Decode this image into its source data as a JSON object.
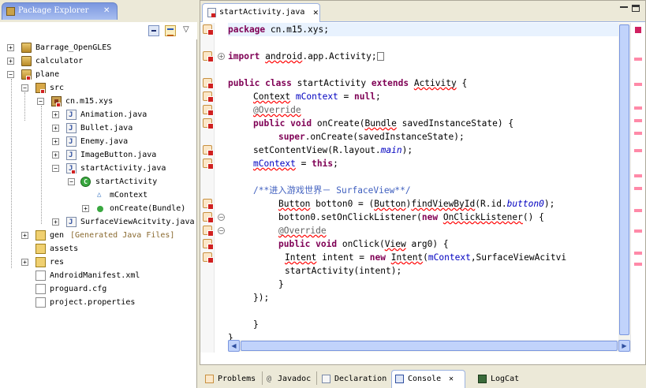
{
  "package_explorer": {
    "title": "Package Explorer",
    "close_glyph": "✕",
    "menu_glyph": "▽",
    "tree": [
      {
        "label": "Barrage_OpenGLES",
        "expander": "+"
      },
      {
        "label": "calculator",
        "expander": "+"
      },
      {
        "label": "plane",
        "expander": "−"
      },
      {
        "label": "src",
        "expander": "−"
      },
      {
        "label": "cn.m15.xys",
        "expander": "−"
      },
      {
        "label": "Animation.java",
        "expander": "+"
      },
      {
        "label": "Bullet.java",
        "expander": "+"
      },
      {
        "label": "Enemy.java",
        "expander": "+"
      },
      {
        "label": "ImageButton.java",
        "expander": "+"
      },
      {
        "label": "startActivity.java",
        "expander": "−"
      },
      {
        "label": "startActivity",
        "expander": "−",
        "icon_letter": "C"
      },
      {
        "label": "mContext"
      },
      {
        "label": "onCreate(Bundle)",
        "expander": "+"
      },
      {
        "label": "SurfaceViewAcitvity.java",
        "expander": "+"
      },
      {
        "label": "gen",
        "expander": "+",
        "suffix": "[Generated Java Files]"
      },
      {
        "label": "assets"
      },
      {
        "label": "res",
        "expander": "+"
      },
      {
        "label": "AndroidManifest.xml"
      },
      {
        "label": "proguard.cfg"
      },
      {
        "label": "project.properties"
      }
    ]
  },
  "editor": {
    "tab_title": "startActivity.java",
    "tab_close_glyph": "✕",
    "fold_collapsed": "+",
    "fold_expanded": "−",
    "code": {
      "l1": [
        "package",
        " cn.m15.xys;"
      ],
      "l2": [
        "import",
        " ",
        "android",
        ".app.Activity;"
      ],
      "l3": [
        "public",
        " ",
        "class",
        " startActivity ",
        "extends",
        " ",
        "Activity",
        " {"
      ],
      "l4": [
        "Context",
        " ",
        "mContext",
        " = ",
        "null",
        ";"
      ],
      "l5": [
        "@Override"
      ],
      "l6": [
        "public",
        " ",
        "void",
        " onCreate(",
        "Bundle",
        " savedInstanceState) {"
      ],
      "l7": [
        "super",
        ".onCreate(savedInstanceState);"
      ],
      "l8": [
        "setContentView",
        "(R.layout.",
        "main",
        ");"
      ],
      "l9": [
        "mContext",
        " = ",
        "this",
        ";"
      ],
      "l10": [
        "/**进入游戏世界－ SurfaceView**/"
      ],
      "l11": [
        "Button",
        " botton0 = (",
        "Button",
        ")",
        "findViewById",
        "(R.id.",
        "button0",
        ");"
      ],
      "l12": [
        "botton0.setOnClickListener(",
        "new",
        " ",
        "OnClickListener",
        "() {"
      ],
      "l13": [
        "@Override"
      ],
      "l14": [
        "public",
        " ",
        "void",
        " onClick(",
        "View",
        " arg0) {"
      ],
      "l15": [
        "Intent",
        " intent = ",
        "new",
        " ",
        "Intent",
        "(",
        "mContext",
        ",SurfaceViewAcitvi"
      ],
      "l16": [
        "startActivity(intent);"
      ],
      "l17": [
        "}"
      ],
      "l18": [
        "});"
      ],
      "l19": [
        "}"
      ],
      "l20": [
        "}"
      ]
    }
  },
  "bottom_tabs": [
    {
      "label": "Problems"
    },
    {
      "label": "Javadoc",
      "icon_glyph": "@"
    },
    {
      "label": "Declaration"
    },
    {
      "label": "Console",
      "close_glyph": "✕"
    },
    {
      "label": "LogCat"
    }
  ],
  "colors": {
    "keyword": "#7f0055",
    "field": "#0000c0",
    "comment": "#3f5fbf",
    "annotation": "#646464",
    "error": "#d02020",
    "active_tab": "#7a96df"
  }
}
